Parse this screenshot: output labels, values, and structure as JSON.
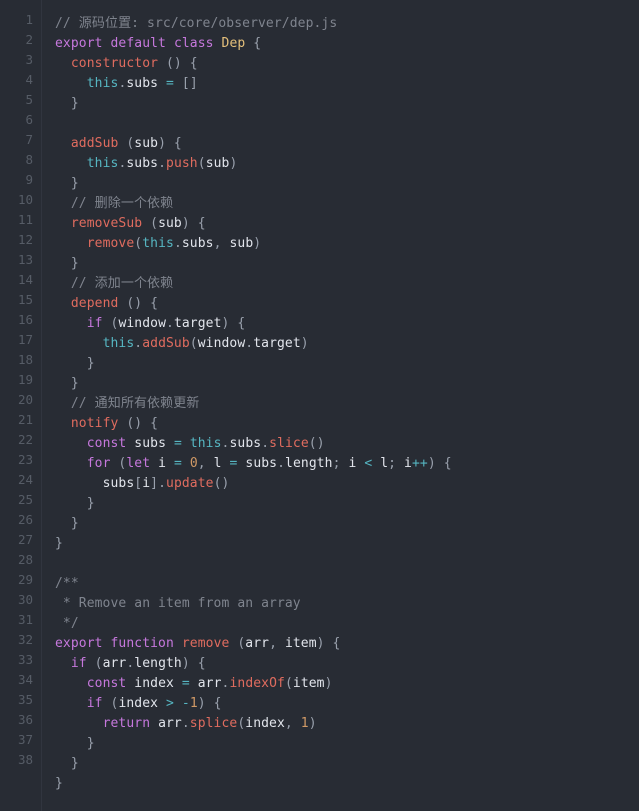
{
  "editor": {
    "language": "javascript",
    "theme": "one-dark",
    "background_color": "#282c34",
    "gutter_color": "#282c34",
    "gutter_text_color": "#565c66",
    "divider_color": "#31353f",
    "total_lines": 38,
    "first_line_number": 1
  },
  "palette": {
    "comment": "#7f848e",
    "keyword": "#c678dd",
    "class_name": "#e5c07b",
    "function_name": "#e06c5f",
    "this_keyword": "#56b6c2",
    "operator": "#56b6c2",
    "number": "#d19a66",
    "variable": "#e2e5ec",
    "punctuation": "#9aa1ad",
    "default_text": "#abb2bf"
  },
  "line_numbers": [
    "1",
    "2",
    "3",
    "4",
    "5",
    "6",
    "7",
    "8",
    "9",
    "10",
    "11",
    "12",
    "13",
    "14",
    "15",
    "16",
    "17",
    "18",
    "19",
    "20",
    "21",
    "22",
    "23",
    "24",
    "25",
    "26",
    "27",
    "28",
    "29",
    "30",
    "31",
    "32",
    "33",
    "34",
    "35",
    "36",
    "37",
    "38"
  ],
  "code_lines": [
    "// 源码位置: src/core/observer/dep.js",
    "export default class Dep {",
    "  constructor () {",
    "    this.subs = []",
    "  }",
    "",
    "  addSub (sub) {",
    "    this.subs.push(sub)",
    "  }",
    "  // 删除一个依赖",
    "  removeSub (sub) {",
    "    remove(this.subs, sub)",
    "  }",
    "  // 添加一个依赖",
    "  depend () {",
    "    if (window.target) {",
    "      this.addSub(window.target)",
    "    }",
    "  }",
    "  // 通知所有依赖更新",
    "  notify () {",
    "    const subs = this.subs.slice()",
    "    for (let i = 0, l = subs.length; i < l; i++) {",
    "      subs[i].update()",
    "    }",
    "  }",
    "}",
    "",
    "/**",
    " * Remove an item from an array",
    " */",
    "export function remove (arr, item) {",
    "  if (arr.length) {",
    "    const index = arr.indexOf(item)",
    "    if (index > -1) {",
    "      return arr.splice(index, 1)",
    "    }",
    "  }",
    "}",
    ""
  ],
  "comments": {
    "source_location": "// 源码位置: src/core/observer/dep.js",
    "remove_dependency": "// 删除一个依赖",
    "add_dependency": "// 添加一个依赖",
    "notify_all_dependencies": "// 通知所有依赖更新",
    "jsdoc_open": "/**",
    "jsdoc_body": " * Remove an item from an array",
    "jsdoc_close": " */"
  },
  "symbols": {
    "class_name": "Dep",
    "methods": [
      "constructor",
      "addSub",
      "removeSub",
      "depend",
      "notify"
    ],
    "exported_function": "remove",
    "function_params": [
      "arr",
      "item"
    ]
  }
}
